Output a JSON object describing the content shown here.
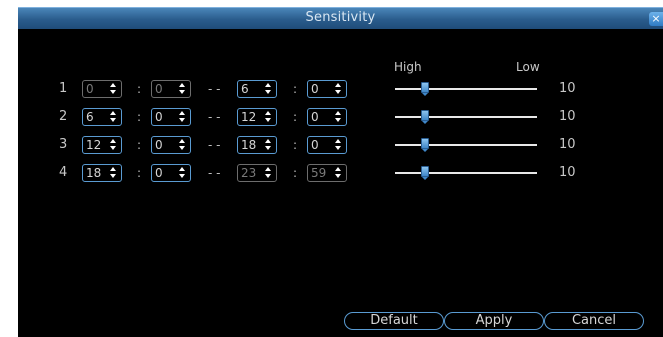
{
  "window": {
    "title": "Sensitivity",
    "close_glyph": "×"
  },
  "columns": {
    "high": "High",
    "low": "Low"
  },
  "rows": [
    {
      "num": "1",
      "start_h": "0",
      "start_m": "0",
      "end_h": "6",
      "end_m": "0",
      "sensitivity": "10",
      "start_disabled": true,
      "end_disabled": false
    },
    {
      "num": "2",
      "start_h": "6",
      "start_m": "0",
      "end_h": "12",
      "end_m": "0",
      "sensitivity": "10",
      "start_disabled": false,
      "end_disabled": false
    },
    {
      "num": "3",
      "start_h": "12",
      "start_m": "0",
      "end_h": "18",
      "end_m": "0",
      "sensitivity": "10",
      "start_disabled": false,
      "end_disabled": false
    },
    {
      "num": "4",
      "start_h": "18",
      "start_m": "0",
      "end_h": "23",
      "end_m": "59",
      "sensitivity": "10",
      "start_disabled": false,
      "end_disabled": true
    }
  ],
  "separators": {
    "colon": ":",
    "dash": "- -"
  },
  "buttons": {
    "default": "Default",
    "apply": "Apply",
    "cancel": "Cancel"
  },
  "colors": {
    "accent": "#5a9bd2",
    "titlebar": "#2a5c8c",
    "background": "#000000",
    "text": "#c8c8c8"
  }
}
